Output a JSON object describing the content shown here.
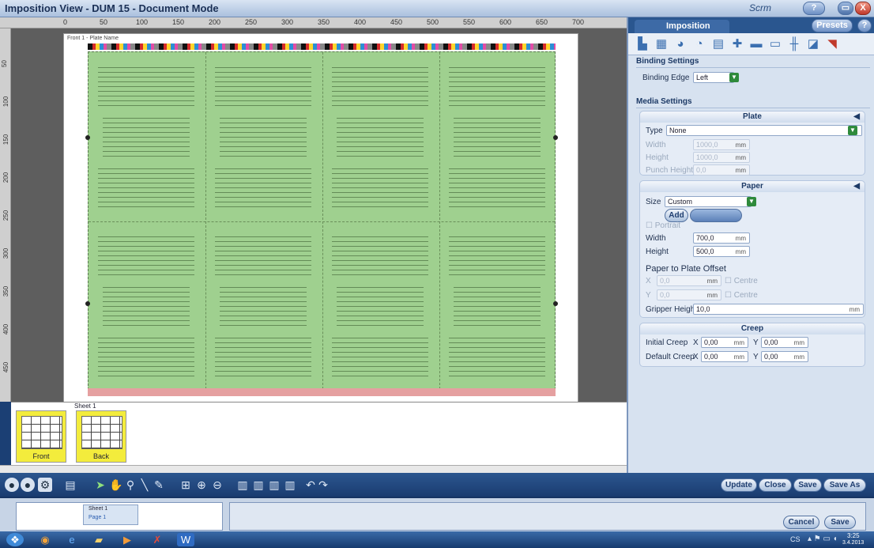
{
  "window": {
    "title": "Imposition View - DUM 15 - Document Mode",
    "logo": "Scrm",
    "help_label": "?",
    "close_label": "X"
  },
  "ruler": {
    "top_ticks": [
      "0",
      "50",
      "100",
      "150",
      "200",
      "250",
      "300",
      "350",
      "400",
      "450",
      "500",
      "550",
      "600",
      "650",
      "700"
    ],
    "left_ticks": [
      "50",
      "100",
      "150",
      "200",
      "250",
      "300",
      "350",
      "400",
      "450"
    ]
  },
  "sheet": {
    "corner_label": "Front 1 - Plate Name"
  },
  "lower": {
    "sheet_name": "Sheet 1",
    "thumbs": [
      {
        "label": "Front"
      },
      {
        "label": "Back"
      }
    ]
  },
  "right_panel": {
    "tab": "Imposition",
    "presets_label": "Presets",
    "binding": {
      "header": "Binding Settings",
      "label": "Binding Edge",
      "value": "Left"
    },
    "media": {
      "header": "Media Settings"
    },
    "plate": {
      "header": "Plate",
      "type_label": "Type",
      "type_value": "None",
      "width_label": "Width",
      "width_value": "1000,0",
      "height_label": "Height",
      "height_value": "1000,0",
      "punch_label": "Punch Height",
      "punch_value": "0,0",
      "unit": "mm"
    },
    "paper": {
      "header": "Paper",
      "size_label": "Size",
      "size_value": "Custom",
      "add_label": "Add",
      "portrait_label": "Portrait",
      "width_label": "Width",
      "width_value": "700,0",
      "height_label": "Height",
      "height_value": "500,0",
      "unit": "mm"
    },
    "offset": {
      "header": "Paper to Plate Offset",
      "x_label": "X",
      "x_value": "0,0",
      "y_label": "Y",
      "y_value": "0,0",
      "centre_label": "Centre",
      "gripper_label": "Gripper Height",
      "gripper_value": "10,0"
    },
    "creep": {
      "header": "Creep",
      "initial_label": "Initial Creep",
      "default_label": "Default Creep",
      "x_label": "X",
      "y_label": "Y",
      "init_x": "0,00",
      "init_y": "0,00",
      "def_x": "0,00",
      "def_y": "0,00",
      "unit": "mm"
    }
  },
  "toolbar": {
    "update": "Update",
    "close": "Close",
    "save": "Save",
    "save_as": "Save As"
  },
  "status": {
    "cancel": "Cancel",
    "save": "Save",
    "small_title": "Sheet 1",
    "small_field": "Page 1"
  },
  "taskbar": {
    "clock_time": "3:25",
    "clock_date": "3.4.2013",
    "tray": "CS"
  }
}
